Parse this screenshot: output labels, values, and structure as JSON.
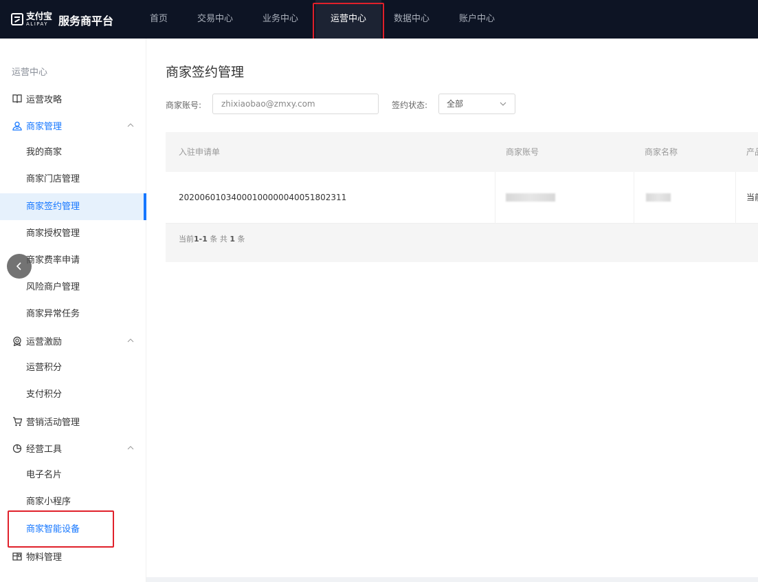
{
  "header": {
    "logo_cn": "支付宝",
    "logo_en": "ALIPAY",
    "platform_title": "服务商平台",
    "nav": [
      "首页",
      "交易中心",
      "业务中心",
      "运营中心",
      "数据中心",
      "账户中心"
    ],
    "active_nav": "运营中心"
  },
  "sidebar": {
    "header": "运营中心",
    "items": [
      {
        "type": "group",
        "label": "运营攻略",
        "icon": "book-icon"
      },
      {
        "type": "group",
        "label": "商家管理",
        "icon": "user-group-icon",
        "expanded": true
      },
      {
        "type": "sub",
        "label": "我的商家"
      },
      {
        "type": "sub",
        "label": "商家门店管理"
      },
      {
        "type": "sub",
        "label": "商家签约管理",
        "active": true
      },
      {
        "type": "sub",
        "label": "商家授权管理"
      },
      {
        "type": "sub",
        "label": "商家费率申请"
      },
      {
        "type": "sub",
        "label": "风险商户管理"
      },
      {
        "type": "sub",
        "label": "商家异常任务"
      },
      {
        "type": "group",
        "label": "运营激励",
        "icon": "badge-icon",
        "expanded": true
      },
      {
        "type": "sub",
        "label": "运营积分"
      },
      {
        "type": "sub",
        "label": "支付积分"
      },
      {
        "type": "group",
        "label": "营销活动管理",
        "icon": "cart-icon"
      },
      {
        "type": "group",
        "label": "经营工具",
        "icon": "pie-icon",
        "expanded": true
      },
      {
        "type": "sub",
        "label": "电子名片"
      },
      {
        "type": "sub",
        "label": "商家小程序"
      },
      {
        "type": "sub",
        "label": "商家智能设备",
        "highlight": true
      },
      {
        "type": "group",
        "label": "物料管理",
        "icon": "material-icon"
      }
    ]
  },
  "main": {
    "title": "商家签约管理",
    "filters": {
      "account_label": "商家账号:",
      "account_value": "zhixiaobao@zmxy.com",
      "status_label": "签约状态:",
      "status_value": "全部"
    },
    "table": {
      "columns": [
        "入驻申请单",
        "商家账号",
        "商家名称",
        "产品"
      ],
      "rows": [
        {
          "application": "20200601034000100000040051802311",
          "account": "",
          "name": "",
          "product": "当前"
        }
      ],
      "pager": {
        "prefix": "当前",
        "range": "1-1",
        "mid": "条 共",
        "total": "1",
        "suffix": "条"
      }
    }
  },
  "colors": {
    "accent": "#1677ff",
    "topbar": "#0d1424",
    "highlight_box": "#e0202a"
  }
}
